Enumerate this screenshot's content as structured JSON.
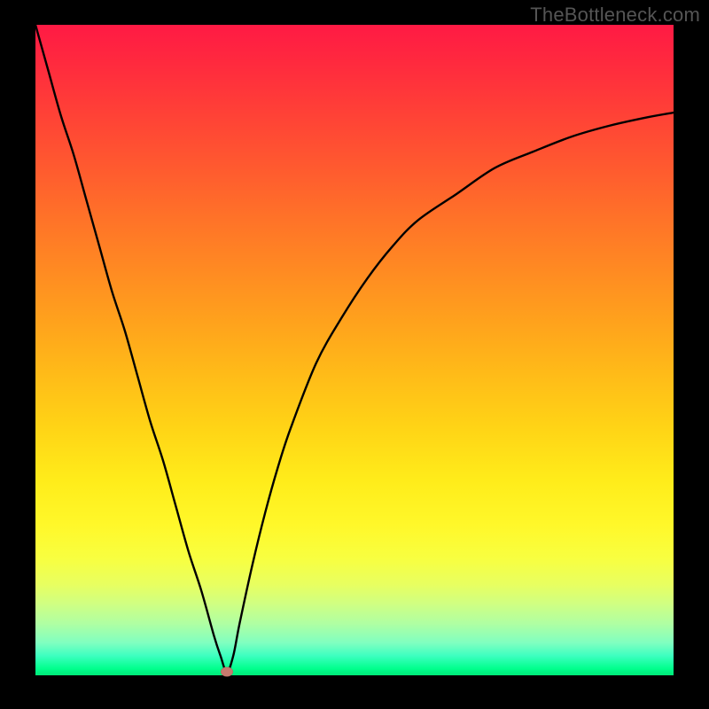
{
  "watermark": "TheBottleneck.com",
  "chart_data": {
    "type": "line",
    "title": "",
    "xlabel": "",
    "ylabel": "",
    "xlim": [
      0,
      100
    ],
    "ylim": [
      0,
      100
    ],
    "grid": false,
    "legend": false,
    "background": "red-yellow-green vertical gradient",
    "series": [
      {
        "name": "bottleneck-curve",
        "x": [
          0,
          2,
          4,
          6,
          8,
          10,
          12,
          14,
          16,
          18,
          20,
          22,
          24,
          26,
          28,
          29,
          30,
          31,
          32,
          34,
          36,
          38,
          40,
          44,
          48,
          52,
          56,
          60,
          66,
          72,
          78,
          84,
          90,
          96,
          100
        ],
        "y": [
          100,
          93,
          86,
          80,
          73,
          66,
          59,
          53,
          46,
          39,
          33,
          26,
          19,
          13,
          6,
          3,
          0.5,
          3,
          8,
          17,
          25,
          32,
          38,
          48,
          55,
          61,
          66,
          70,
          74,
          78,
          80.5,
          82.8,
          84.5,
          85.8,
          86.5
        ]
      }
    ],
    "marker": {
      "x": 30,
      "y": 0.5,
      "color": "#c77a6f"
    },
    "gradient_stops": [
      {
        "pos": 0.0,
        "color": "#ff1a44"
      },
      {
        "pos": 0.5,
        "color": "#ffc018"
      },
      {
        "pos": 0.78,
        "color": "#fff828"
      },
      {
        "pos": 0.95,
        "color": "#80ffc0"
      },
      {
        "pos": 1.0,
        "color": "#00e878"
      }
    ]
  }
}
